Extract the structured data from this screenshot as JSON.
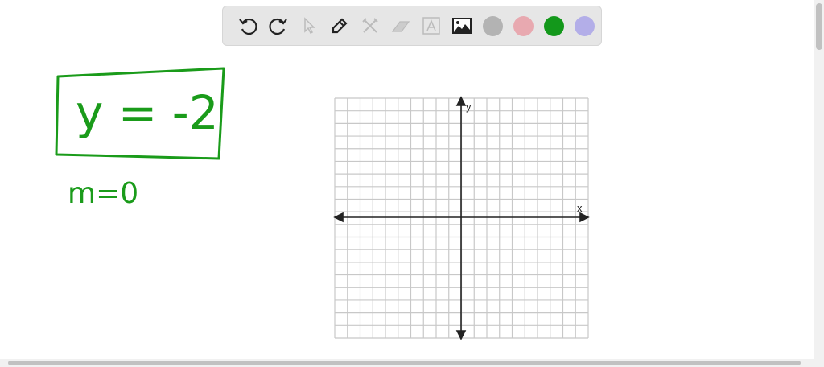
{
  "toolbar": {
    "tools": [
      {
        "name": "undo-icon",
        "enabled": true
      },
      {
        "name": "redo-icon",
        "enabled": true
      },
      {
        "name": "select-pointer-icon",
        "enabled": false
      },
      {
        "name": "pen-icon",
        "enabled": true
      },
      {
        "name": "tools-icon",
        "enabled": false
      },
      {
        "name": "eraser-icon",
        "enabled": false
      },
      {
        "name": "text-box-icon",
        "enabled": false
      },
      {
        "name": "image-icon",
        "enabled": true
      }
    ],
    "colors": [
      "#b3b3b3",
      "#e8a9b0",
      "#13981b",
      "#b3aee8"
    ]
  },
  "whiteboard": {
    "equation": "y = -2",
    "slope": "m=0",
    "ink_color": "#1a9b1a",
    "graph": {
      "x_label": "x",
      "y_label": "y",
      "columns": 20,
      "rows": 19
    }
  }
}
